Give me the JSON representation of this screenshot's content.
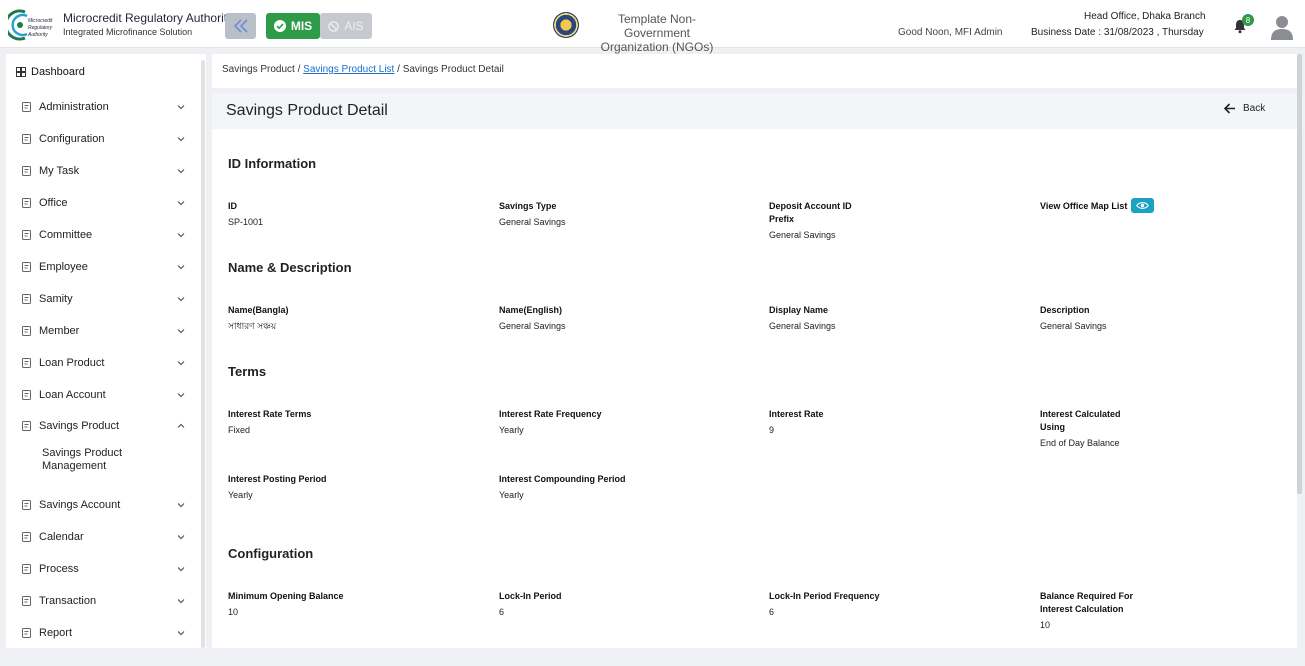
{
  "header": {
    "logo_text": "Microcredit Regulatory Authority",
    "org_title": "Microcredit Regulatory Authority",
    "org_subtitle": "Integrated Microfinance Solution",
    "mis_label": "MIS",
    "ais_label": "AIS",
    "ngo_line1": "Template Non-Government",
    "ngo_line2": "Organization (NGOs)",
    "greeting": "Good Noon, MFI Admin",
    "branch": "Head Office, Dhaka Branch",
    "business_date": "Business Date : 31/08/2023 , Thursday",
    "notification_count": "8",
    "accent_color": "#2d9b48"
  },
  "sidebar": {
    "dashboard": "Dashboard",
    "items": [
      {
        "label": "Administration",
        "icon": "admin-icon",
        "expanded": false
      },
      {
        "label": "Configuration",
        "icon": "config-icon",
        "expanded": false
      },
      {
        "label": "My Task",
        "icon": "task-icon",
        "expanded": false
      },
      {
        "label": "Office",
        "icon": "office-icon",
        "expanded": false
      },
      {
        "label": "Committee",
        "icon": "committee-icon",
        "expanded": false
      },
      {
        "label": "Employee",
        "icon": "employee-icon",
        "expanded": false
      },
      {
        "label": "Samity",
        "icon": "samity-icon",
        "expanded": false
      },
      {
        "label": "Member",
        "icon": "member-icon",
        "expanded": false
      },
      {
        "label": "Loan Product",
        "icon": "loan-product-icon",
        "expanded": false
      },
      {
        "label": "Loan Account",
        "icon": "loan-account-icon",
        "expanded": false
      },
      {
        "label": "Savings Product",
        "icon": "savings-product-icon",
        "expanded": true
      },
      {
        "label": "Savings Account",
        "icon": "savings-account-icon",
        "expanded": false
      },
      {
        "label": "Calendar",
        "icon": "calendar-icon",
        "expanded": false
      },
      {
        "label": "Process",
        "icon": "process-icon",
        "expanded": false
      },
      {
        "label": "Transaction",
        "icon": "transaction-icon",
        "expanded": false
      },
      {
        "label": "Report",
        "icon": "report-icon",
        "expanded": false
      }
    ],
    "sub_item": "Savings Product Management"
  },
  "breadcrumb": {
    "first": "Savings Product",
    "link": "Savings Product List",
    "current": "Savings Product Detail"
  },
  "main": {
    "title": "Savings Product Detail",
    "back_label": "Back",
    "sections": [
      {
        "title": "ID Information",
        "fields": [
          {
            "label": "ID",
            "value": "SP-1001"
          },
          {
            "label": "Savings Type",
            "value": "General Savings"
          },
          {
            "label": "Deposit Account ID Prefix",
            "value": "General Savings"
          },
          {
            "label": "View Office Map List",
            "value": ""
          }
        ]
      },
      {
        "title": "Name & Description",
        "fields": [
          {
            "label": "Name(Bangla)",
            "value": "সাধারণ সঞ্চয়"
          },
          {
            "label": "Name(English)",
            "value": "General Savings"
          },
          {
            "label": "Display Name",
            "value": "General Savings"
          },
          {
            "label": "Description",
            "value": "General Savings"
          }
        ]
      },
      {
        "title": "Terms",
        "fields": [
          {
            "label": "Interest Rate Terms",
            "value": "Fixed"
          },
          {
            "label": "Interest Rate Frequency",
            "value": "Yearly"
          },
          {
            "label": "Interest Rate",
            "value": "9"
          },
          {
            "label": "Interest Calculated Using",
            "value": "End of Day Balance"
          },
          {
            "label": "Interest Posting Period",
            "value": "Yearly"
          },
          {
            "label": "Interest Compounding Period",
            "value": "Yearly"
          }
        ]
      },
      {
        "title": "Configuration",
        "fields": [
          {
            "label": "Minimum Opening Balance",
            "value": "10"
          },
          {
            "label": "Lock-In Period",
            "value": "6"
          },
          {
            "label": "Lock-In Period Frequency",
            "value": "6"
          },
          {
            "label": "Balance Required For Interest Calculation",
            "value": "10"
          }
        ]
      }
    ]
  }
}
